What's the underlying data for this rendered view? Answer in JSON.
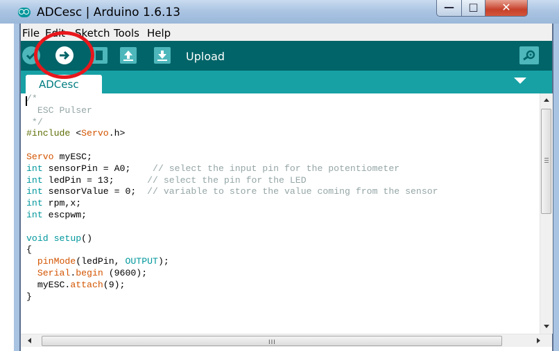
{
  "window": {
    "title": "ADCesc | Arduino 1.6.13",
    "controls": {
      "minimize_glyph": "—",
      "maximize_glyph": "□",
      "close_glyph": "✕"
    }
  },
  "menu": {
    "items": [
      "File",
      "Edit",
      "Sketch",
      "Tools",
      "Help"
    ]
  },
  "toolbar": {
    "buttons": [
      "verify",
      "upload",
      "new",
      "open",
      "save"
    ],
    "hover_label": "Upload",
    "serial_monitor_icon": "magnifier-icon"
  },
  "tabs": [
    {
      "label": "ADCesc",
      "active": true
    }
  ],
  "editor": {
    "code": [
      [
        [
          "c-cm",
          "/*"
        ]
      ],
      [
        [
          "c-cm",
          "  ESC Pulser"
        ]
      ],
      [
        [
          "c-cm",
          " */"
        ]
      ],
      [
        [
          "c-pp",
          "#include"
        ],
        [
          "",
          " <"
        ],
        [
          "c-kw",
          "Servo"
        ],
        [
          "",
          ".h>"
        ]
      ],
      [
        [
          "",
          ""
        ]
      ],
      [
        [
          "c-kw",
          "Servo"
        ],
        [
          "",
          " myESC;"
        ]
      ],
      [
        [
          "c-ty",
          "int"
        ],
        [
          "",
          " sensorPin = A0;    "
        ],
        [
          "c-cm",
          "// select the input pin for the potentiometer"
        ]
      ],
      [
        [
          "c-ty",
          "int"
        ],
        [
          "",
          " ledPin = 13;      "
        ],
        [
          "c-cm",
          "// select the pin for the LED"
        ]
      ],
      [
        [
          "c-ty",
          "int"
        ],
        [
          "",
          " sensorValue = 0;  "
        ],
        [
          "c-cm",
          "// variable to store the value coming from the sensor"
        ]
      ],
      [
        [
          "c-ty",
          "int"
        ],
        [
          "",
          " rpm,x;"
        ]
      ],
      [
        [
          "c-ty",
          "int"
        ],
        [
          "",
          " escpwm;"
        ]
      ],
      [
        [
          "",
          ""
        ]
      ],
      [
        [
          "c-ty",
          "void"
        ],
        [
          "",
          " "
        ],
        [
          "c-ty",
          "setup"
        ],
        [
          "",
          "()"
        ]
      ],
      [
        [
          "",
          "{"
        ]
      ],
      [
        [
          "",
          "  "
        ],
        [
          "c-kw",
          "pinMode"
        ],
        [
          "",
          "(ledPin, "
        ],
        [
          "c-ty",
          "OUTPUT"
        ],
        [
          "",
          ");"
        ]
      ],
      [
        [
          "",
          "  "
        ],
        [
          "c-kw",
          "Serial"
        ],
        [
          "",
          "."
        ],
        [
          "c-kw",
          "begin"
        ],
        [
          "",
          " (9600);"
        ]
      ],
      [
        [
          "",
          "  myESC."
        ],
        [
          "c-kw",
          "attach"
        ],
        [
          "",
          "(9);"
        ]
      ],
      [
        [
          "",
          "}"
        ]
      ]
    ]
  },
  "scrollbars": {
    "horizontal_grip": "III"
  },
  "annotation": {
    "color": "#e8171c",
    "target": "upload-button"
  },
  "colors": {
    "toolbar": "#006468",
    "tabstrip": "#17a1a5",
    "button": "#4db7bb",
    "accent": "#00979c"
  }
}
